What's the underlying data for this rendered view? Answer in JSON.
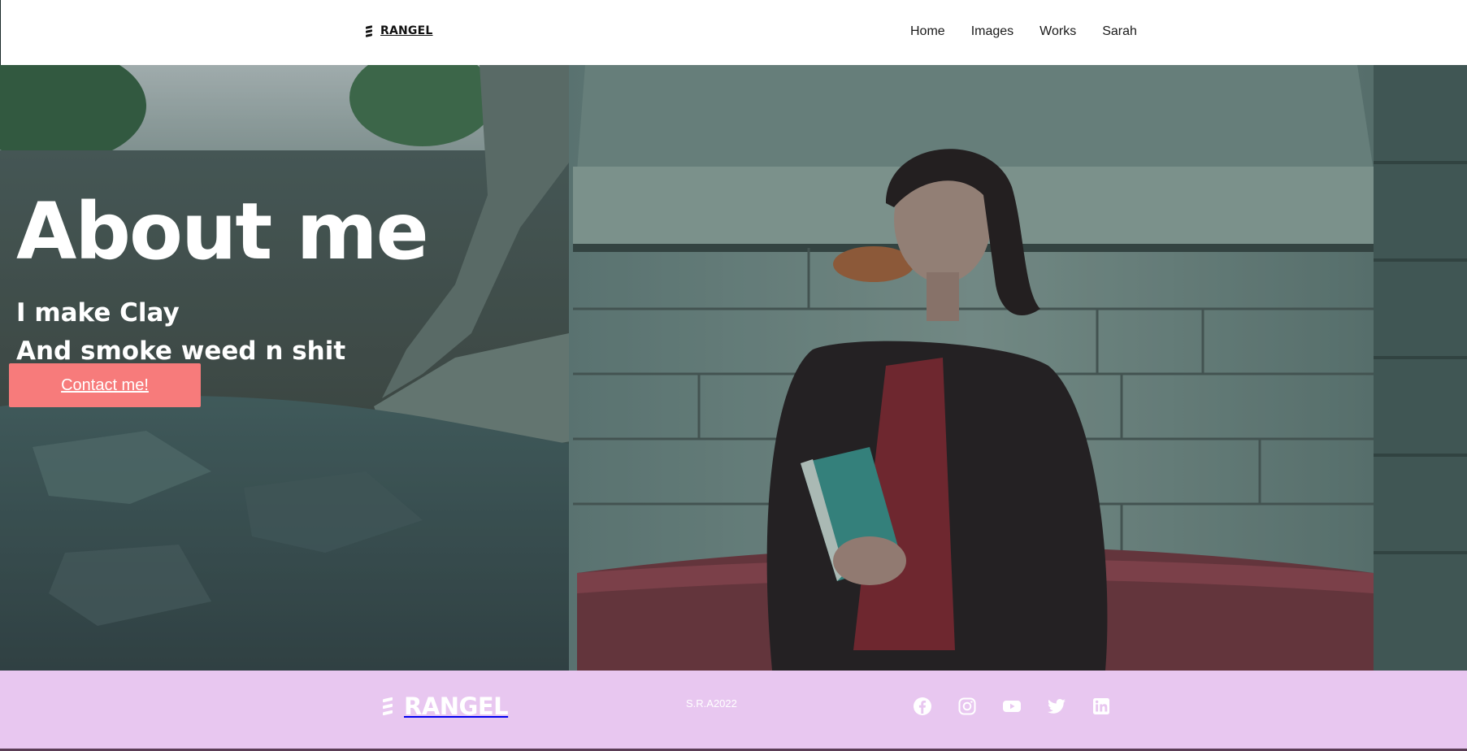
{
  "header": {
    "brand": "RANGEL",
    "nav": [
      "Home",
      "Images",
      "Works",
      "Sarah"
    ]
  },
  "hero": {
    "title": "About me",
    "line1": "I make Clay",
    "line2": "And smoke weed n shit",
    "button": "Contact me!"
  },
  "footer": {
    "brand": "RANGEL",
    "copyright": "S.R.A2022",
    "socials": [
      "facebook-icon",
      "instagram-icon",
      "youtube-icon",
      "twitter-icon",
      "linkedin-icon"
    ]
  },
  "colors": {
    "button": "#f77b7b",
    "footer_bg": "#e8c7f0",
    "hero_tint": "#4a5f5d"
  }
}
